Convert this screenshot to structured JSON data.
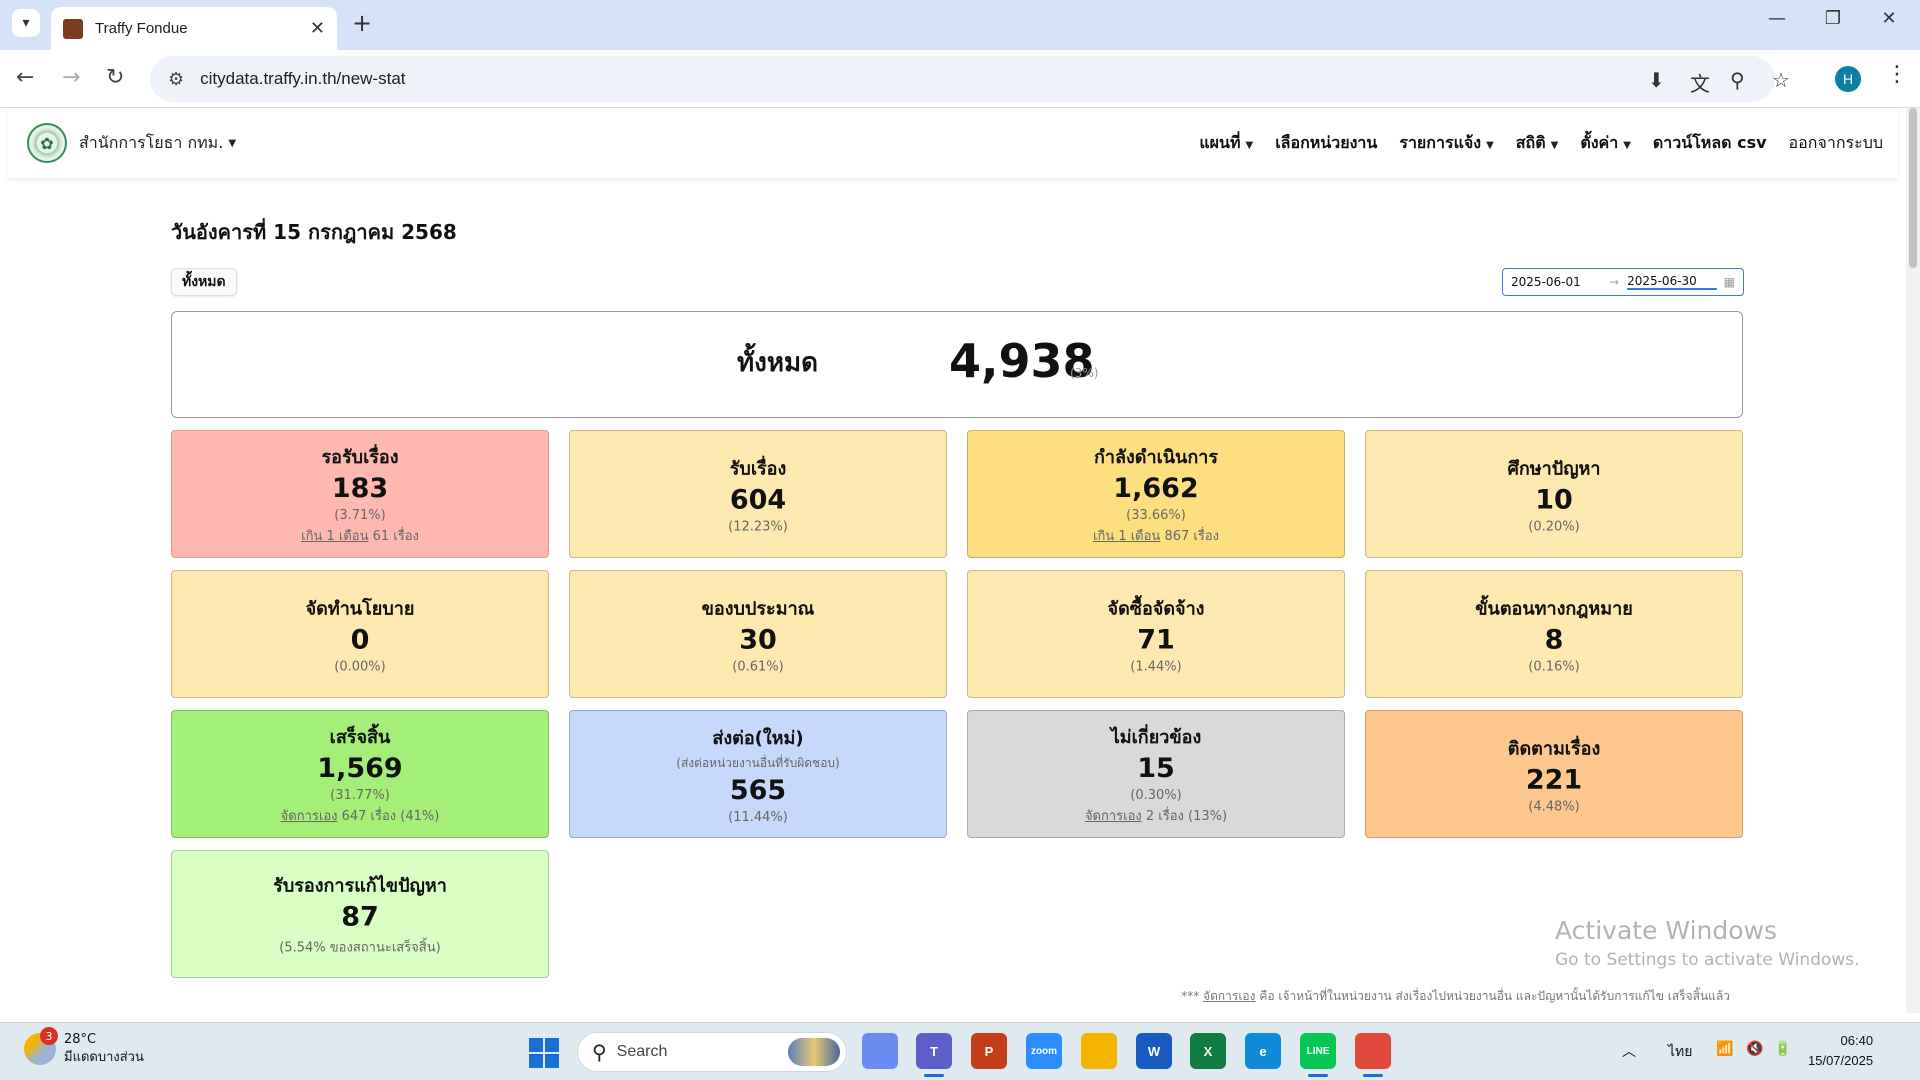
{
  "browser": {
    "tab_title": "Traffy Fondue",
    "url": "citydata.traffy.in.th/new-stat"
  },
  "site": {
    "brand": "สำนักการโยธา กทม.",
    "nav": [
      {
        "label": "แผนที่",
        "dropdown": true
      },
      {
        "label": "เลือกหน่วยงาน",
        "dropdown": false
      },
      {
        "label": "รายการแจ้ง",
        "dropdown": true
      },
      {
        "label": "สถิติ",
        "dropdown": true
      },
      {
        "label": "ตั้งค่า",
        "dropdown": true
      },
      {
        "label": "ดาวน์โหลด csv",
        "dropdown": false
      },
      {
        "label": "ออกจากระบบ",
        "dropdown": false
      }
    ]
  },
  "page": {
    "date_heading": "วันอังคารที่ 15 กรกฎาคม 2568",
    "filter_button": "ทั้งหมด",
    "date_from": "2025-06-01",
    "date_to": "2025-06-30",
    "total": {
      "label": "ทั้งหมด",
      "value": "4,938",
      "pct": "(3%)"
    }
  },
  "cards": [
    {
      "title": "รอรับเรื่อง",
      "value": "183",
      "pct": "(3.71%)",
      "extra_link": "เกิน 1 เดือน",
      "extra_text": " 61 เรื่อง",
      "bg": "#ffb8b0",
      "border": "#d99a92"
    },
    {
      "title": "รับเรื่อง",
      "value": "604",
      "pct": "(12.23%)",
      "bg": "#fde9b0",
      "border": "#c9b888"
    },
    {
      "title": "กำลังดำเนินการ",
      "value": "1,662",
      "pct": "(33.66%)",
      "extra_link": "เกิน 1 เดือน",
      "extra_text": " 867 เรื่อง",
      "bg": "#fddf80",
      "border": "#c9b060"
    },
    {
      "title": "ศึกษาปัญหา",
      "value": "10",
      "pct": "(0.20%)",
      "bg": "#fde9b0",
      "border": "#c9b888"
    },
    {
      "title": "จัดทำนโยบาย",
      "value": "0",
      "pct": "(0.00%)",
      "bg": "#fde9b0",
      "border": "#c9b888"
    },
    {
      "title": "ของบประมาณ",
      "value": "30",
      "pct": "(0.61%)",
      "bg": "#fde9b0",
      "border": "#c9b888"
    },
    {
      "title": "จัดซื้อจัดจ้าง",
      "value": "71",
      "pct": "(1.44%)",
      "bg": "#fde9b0",
      "border": "#c9b888"
    },
    {
      "title": "ขั้นตอนทางกฎหมาย",
      "value": "8",
      "pct": "(0.16%)",
      "bg": "#fde9b0",
      "border": "#c9b888"
    },
    {
      "title": "เสร็จสิ้น",
      "value": "1,569",
      "pct": "(31.77%)",
      "extra_link": "จัดการเอง",
      "extra_text": " 647 เรื่อง (41%)",
      "bg": "#a3ef78",
      "border": "#7fbf5a"
    },
    {
      "title": "ส่งต่อ(ใหม่)",
      "sub": "(ส่งต่อหน่วยงานอื่นที่รับผิดชอบ)",
      "value": "565",
      "pct": "(11.44%)",
      "bg": "#c6d8fb",
      "border": "#98a9c9"
    },
    {
      "title": "ไม่เกี่ยวข้อง",
      "value": "15",
      "pct": "(0.30%)",
      "extra_link": "จัดการเอง",
      "extra_text": " 2 เรื่อง (13%)",
      "bg": "#d9d9d9",
      "border": "#aaaaaa"
    },
    {
      "title": "ติดตามเรื่อง",
      "value": "221",
      "pct": "(4.48%)",
      "bg": "#fdc78d",
      "border": "#d4a06a"
    },
    {
      "title": "รับรองการแก้ไขปัญหา",
      "value": "87",
      "pct": "(5.54% ของสถานะเสร็จสิ้น)",
      "bg": "#d9ffc4",
      "border": "#a9d098"
    }
  ],
  "footnote": {
    "prefix": "*** ",
    "link": "จัดการเอง",
    "text": " คือ เจ้าหน้าที่ในหน่วยงาน ส่งเรื่องไปหน่วยงานอื่น และปัญหานั้นได้รับการแก้ไข เสร็จสิ้นแล้ว"
  },
  "windows_activation": {
    "line1": "Activate Windows",
    "line2": "Go to Settings to activate Windows."
  },
  "taskbar": {
    "weather_temp": "28°C",
    "weather_desc": "มีแดดบางส่วน",
    "weather_badge": "3",
    "search_placeholder": "Search",
    "language": "ไทย",
    "time": "06:40",
    "date": "15/07/2025",
    "apps": [
      {
        "name": "copilot",
        "label": "",
        "color": "#6a8cf0"
      },
      {
        "name": "teams",
        "label": "T",
        "color": "#5b5fc7",
        "active": true
      },
      {
        "name": "powerpoint",
        "label": "P",
        "color": "#c43e1c"
      },
      {
        "name": "zoom",
        "label": "zoom",
        "color": "#2d8cff"
      },
      {
        "name": "file-explorer",
        "label": "",
        "color": "#f4b400"
      },
      {
        "name": "word",
        "label": "W",
        "color": "#185abd"
      },
      {
        "name": "excel",
        "label": "X",
        "color": "#107c41"
      },
      {
        "name": "edge",
        "label": "e",
        "color": "#0f8ad8"
      },
      {
        "name": "line",
        "label": "LINE",
        "color": "#06c755",
        "active": true
      },
      {
        "name": "chrome",
        "label": "",
        "color": "#e0493b",
        "active": true
      }
    ]
  },
  "profile_initial": "H"
}
